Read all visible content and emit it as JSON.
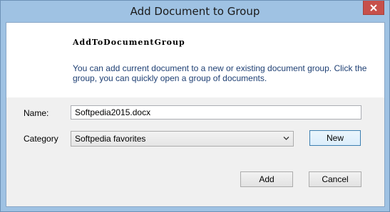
{
  "window": {
    "title": "Add Document to Group",
    "close_icon": "close-icon"
  },
  "header": {
    "heading": "AddToDocumentGroup",
    "description": "You can add current document to a new or existing document group. Click the group, you can quickly open a group of documents."
  },
  "form": {
    "name_label": "Name:",
    "name_value": "Softpedia2015.docx",
    "category_label": "Category",
    "category_value": "Softpedia favorites",
    "dropdown_icon": "chevron-down-icon"
  },
  "buttons": {
    "new_label": "New",
    "add_label": "Add",
    "cancel_label": "Cancel"
  },
  "colors": {
    "frame": "#9fc2e3",
    "close_button": "#c7504b",
    "description_text": "#1e3f73"
  }
}
